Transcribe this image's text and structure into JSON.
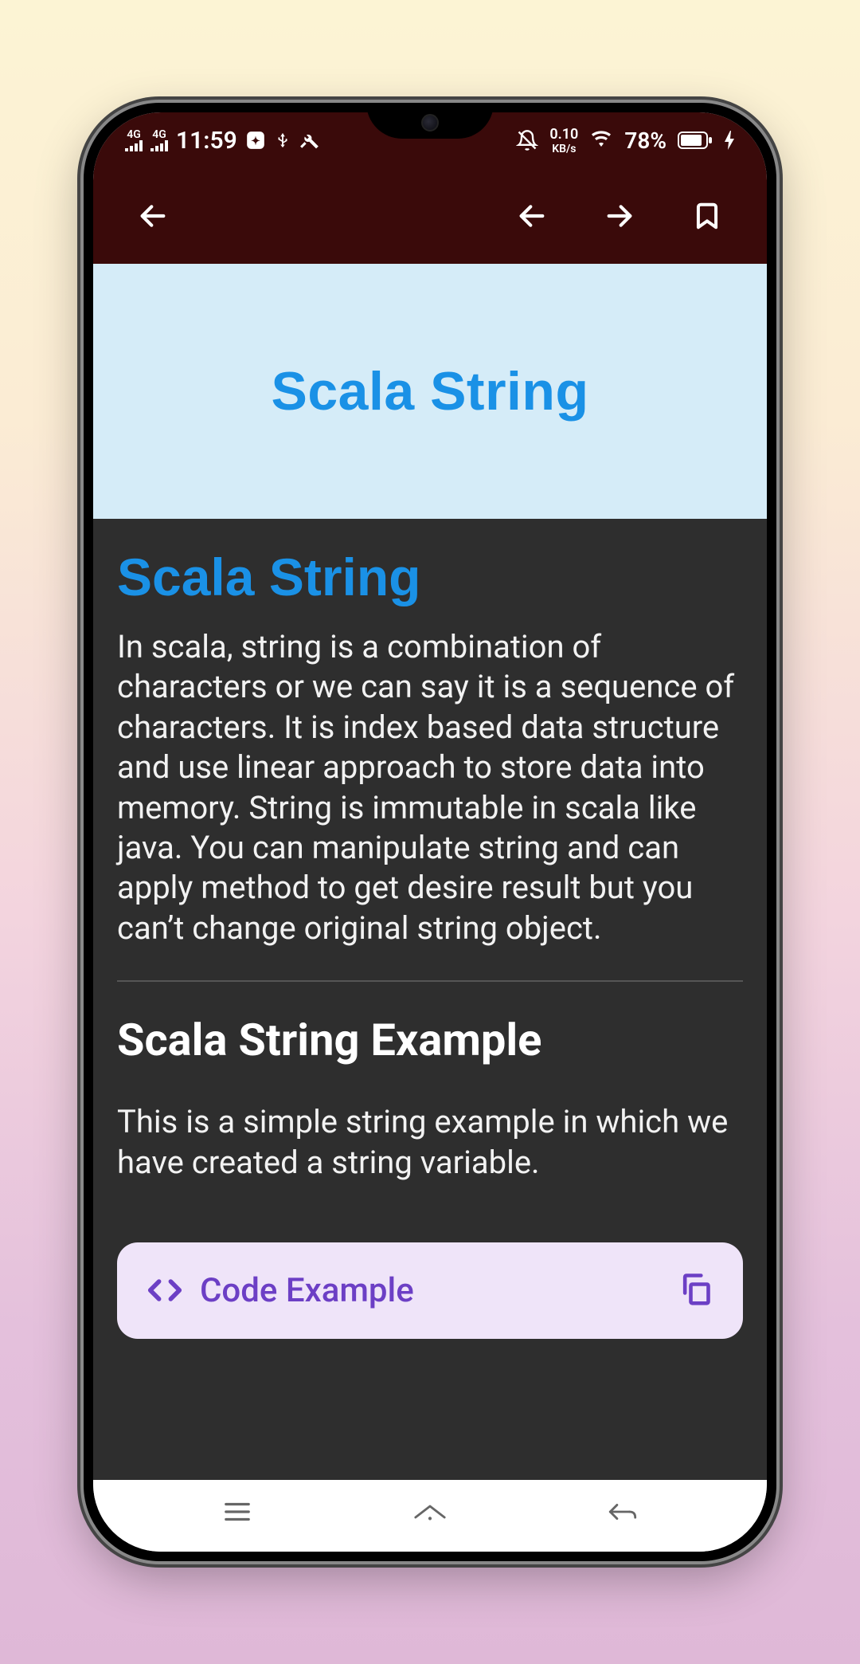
{
  "status": {
    "signal1_label": "4G",
    "signal2_label": "4G",
    "time": "11:59",
    "data_rate_value": "0.10",
    "data_rate_unit": "KB/s",
    "battery_pct": "78%"
  },
  "hero": {
    "title": "Scala String"
  },
  "article": {
    "heading": "Scala String",
    "body": "In scala, string is a combination of characters or we can say it is a sequence of characters. It is index based data structure and use linear approach to store data into memory. String is immutable in scala like java. You can manipulate string and can apply method to get desire result but you can’t change original string object.",
    "example_heading": "Scala String Example",
    "example_body": "This is a simple string example in which we have created a string variable."
  },
  "code_card": {
    "label": "Code Example"
  }
}
